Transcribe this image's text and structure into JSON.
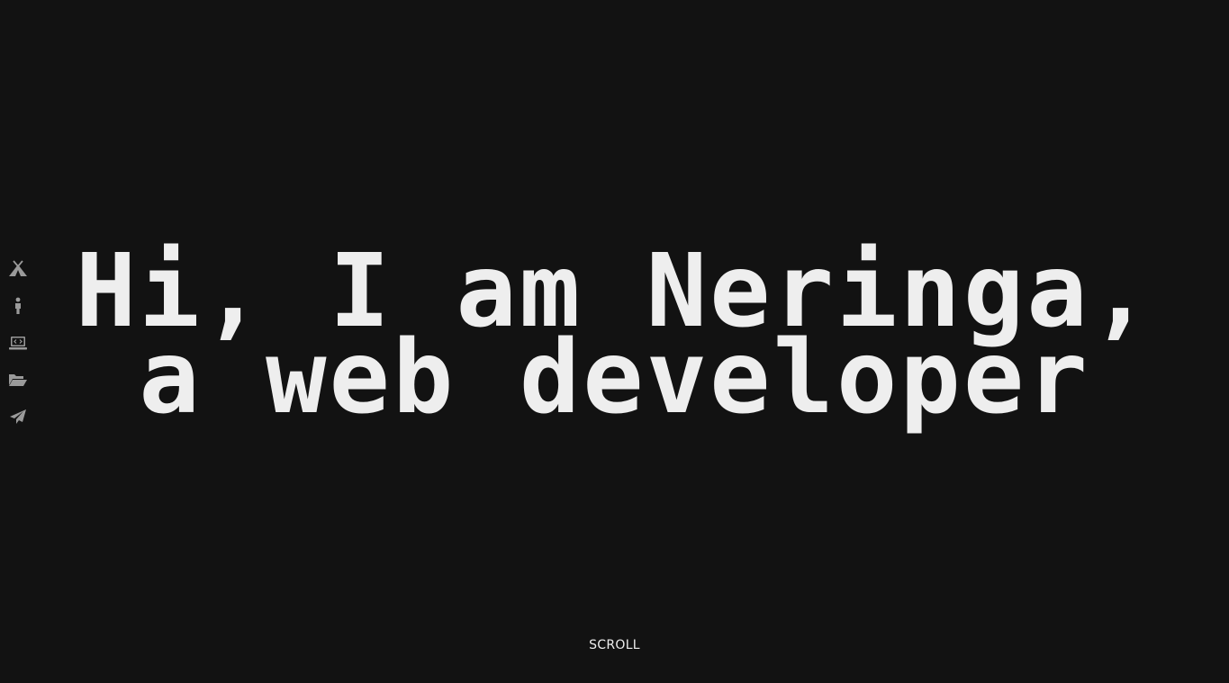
{
  "nav": {
    "items": [
      {
        "icon": "camp-tent-icon"
      },
      {
        "icon": "person-icon"
      },
      {
        "icon": "laptop-code-icon"
      },
      {
        "icon": "folder-open-icon"
      },
      {
        "icon": "paper-plane-icon"
      }
    ],
    "icon_color": "#9a9a9a"
  },
  "hero": {
    "line1": "Hi, I am Neringa,",
    "line2": "a web developer"
  },
  "scroll_label": "SCROLL",
  "colors": {
    "background": "#121212",
    "text": "#eeeeee"
  }
}
